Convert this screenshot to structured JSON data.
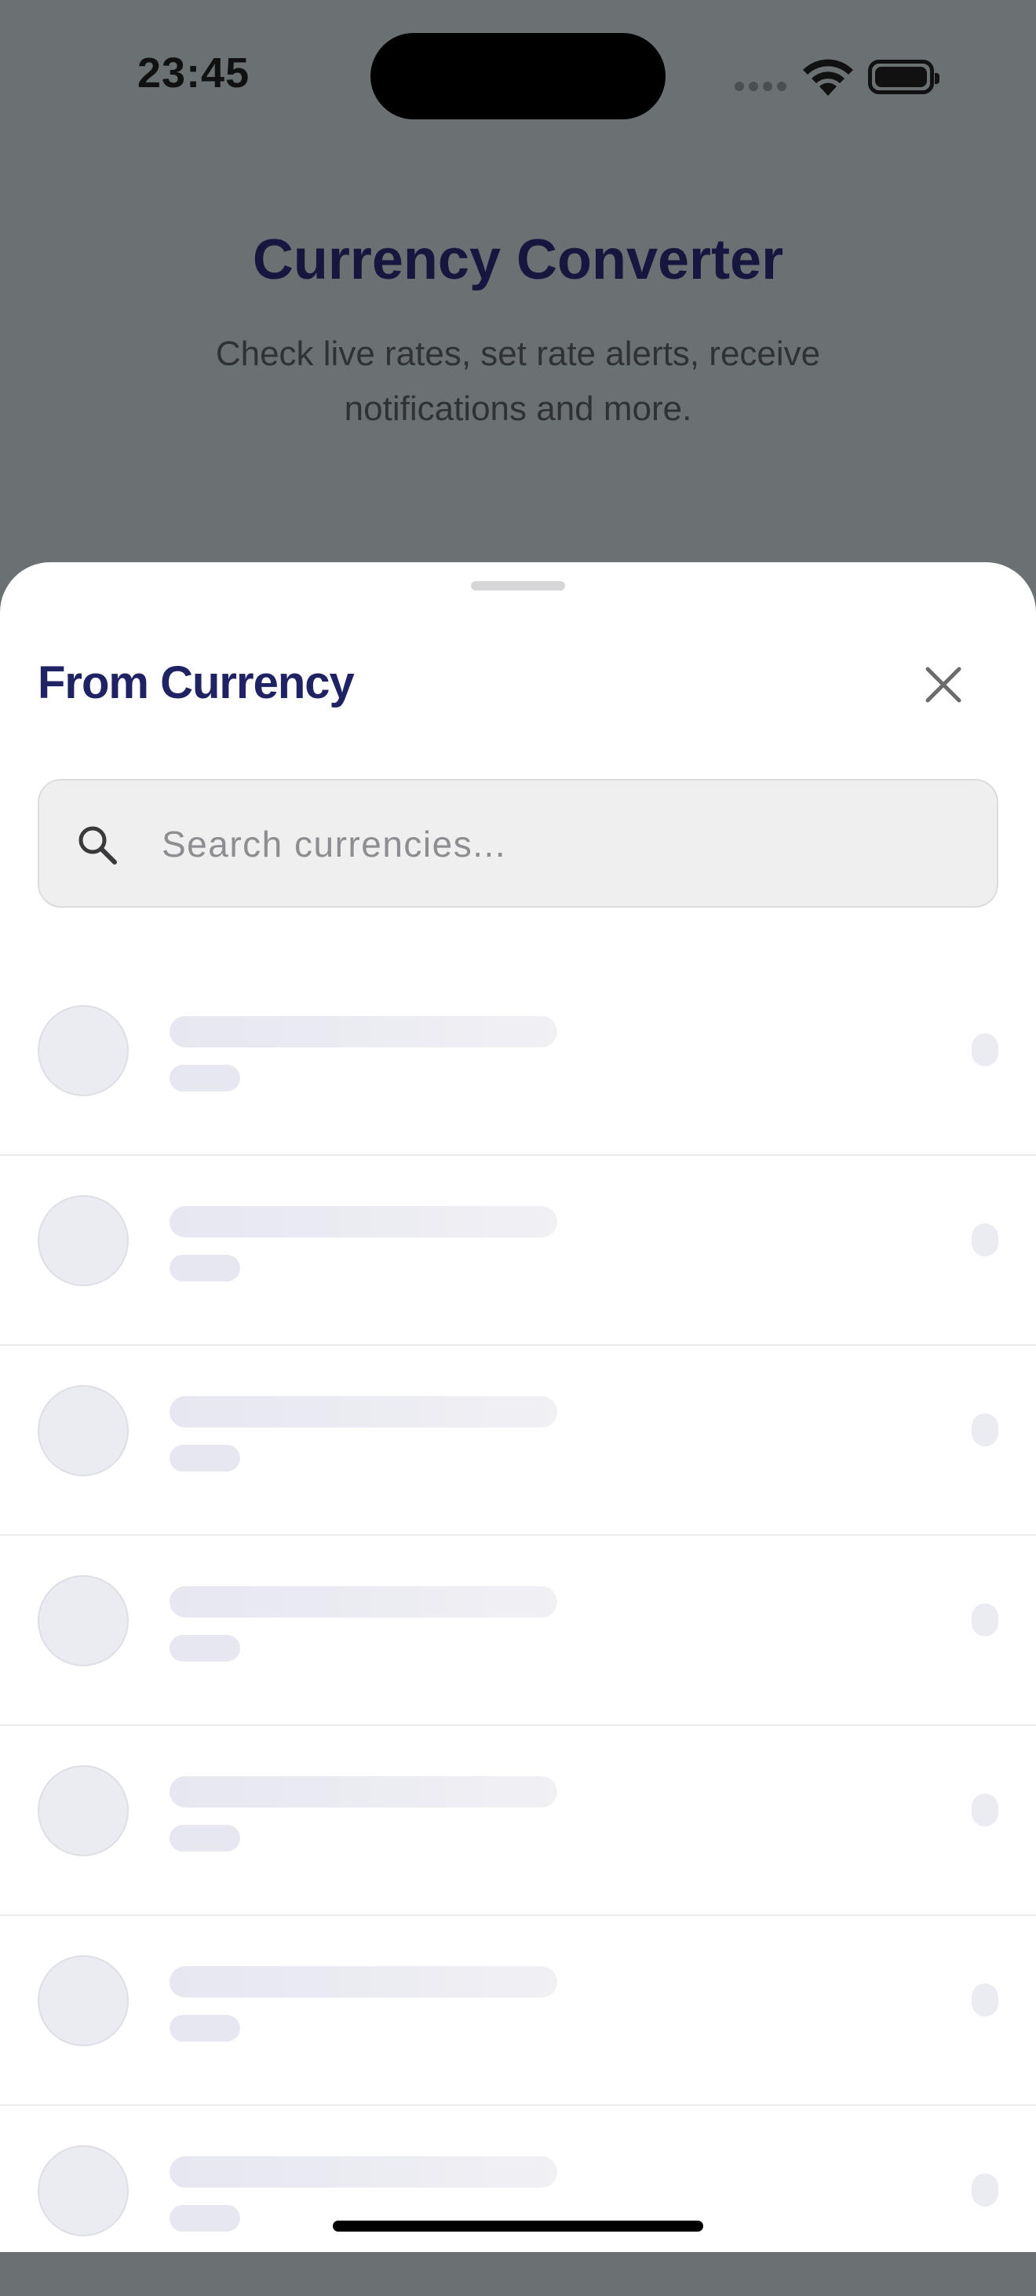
{
  "status_bar": {
    "time": "23:45"
  },
  "background_screen": {
    "title": "Currency Converter",
    "subtitle": "Check live rates, set rate alerts, receive notifications and more."
  },
  "sheet": {
    "title": "From Currency",
    "search": {
      "placeholder": "Search currencies...",
      "value": ""
    },
    "loading_rows": 7
  },
  "icons": {
    "close": "close-icon",
    "search": "search-icon",
    "wifi": "wifi-icon",
    "battery": "battery-icon",
    "signal": "cellular-signal-icon"
  },
  "colors": {
    "title_navy": "#1f2263",
    "dim_overlay": "#6b7173",
    "skeleton": "#e7e7f1"
  }
}
